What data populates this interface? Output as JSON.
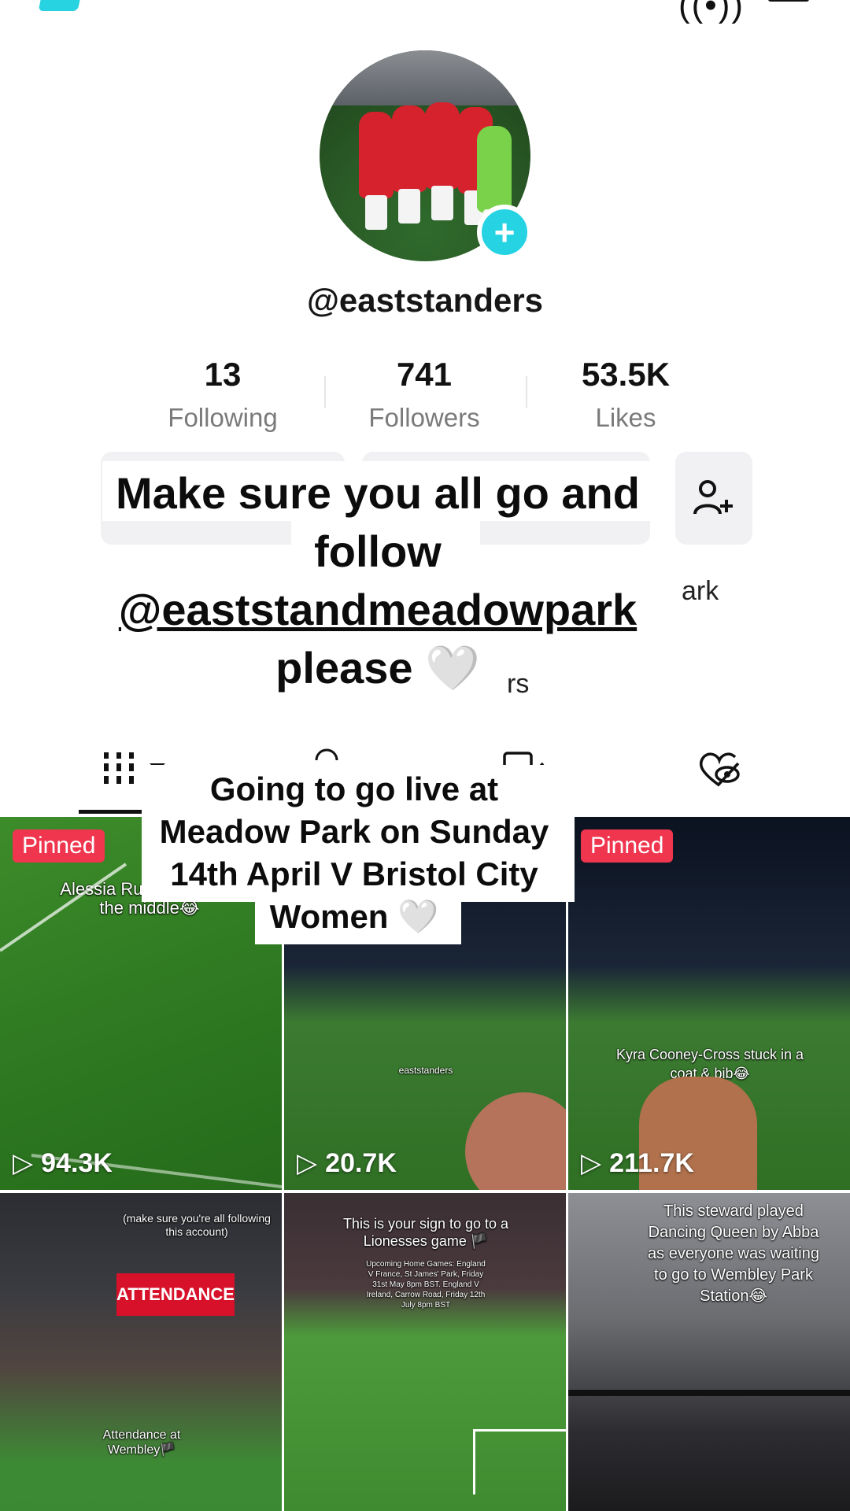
{
  "profile": {
    "username": "@eaststanders",
    "stats": [
      {
        "value": "13",
        "label": "Following"
      },
      {
        "value": "741",
        "label": "Followers"
      },
      {
        "value": "53.5K",
        "label": "Likes"
      }
    ],
    "bio_fragment_1": "ark",
    "bio_fragment_2": "rs"
  },
  "overlay_caption": {
    "line1": "Make sure you all go and",
    "line2": "follow",
    "line3": "@eaststandmeadowpark",
    "line4": "please 🤍"
  },
  "live_caption": {
    "line1": "Going to go live at",
    "line2": "Meadow Park on Sunday",
    "line3": "14th April V Bristol City",
    "line4": "Women 🤍"
  },
  "tabs": [
    "videos-tab",
    "reposts-tab",
    "private-tab",
    "liked-tab"
  ],
  "videos": [
    {
      "pinned": "Pinned",
      "caption": "Alessia Rus... Kyra into the middle😂",
      "views": "94.3K"
    },
    {
      "pinned": "",
      "caption": "eaststanders",
      "views": "20.7K"
    },
    {
      "pinned": "Pinned",
      "caption": "Kyra Cooney-Cross stuck in a coat & bib😂",
      "views": "211.7K"
    },
    {
      "pinned": "",
      "caption_top": "(make sure you're all following this account)",
      "caption_bottom": "Attendance at Wembley🏴",
      "banner": "ATTENDANCE",
      "views": ""
    },
    {
      "pinned": "",
      "caption_top": "This is your sign to go to a Lionesses game 🏴",
      "caption_small": "Upcoming Home Games: England V France, St James' Park, Friday 31st May 8pm BST. England V Ireland, Carrow Road, Friday 12th July 8pm BST",
      "views": ""
    },
    {
      "pinned": "",
      "caption_top": "This steward played Dancing Queen by Abba as everyone was waiting to go to Wembley Park Station😂",
      "views": ""
    }
  ],
  "colors": {
    "accent": "#25d3e3",
    "pinned": "#f0354f"
  }
}
